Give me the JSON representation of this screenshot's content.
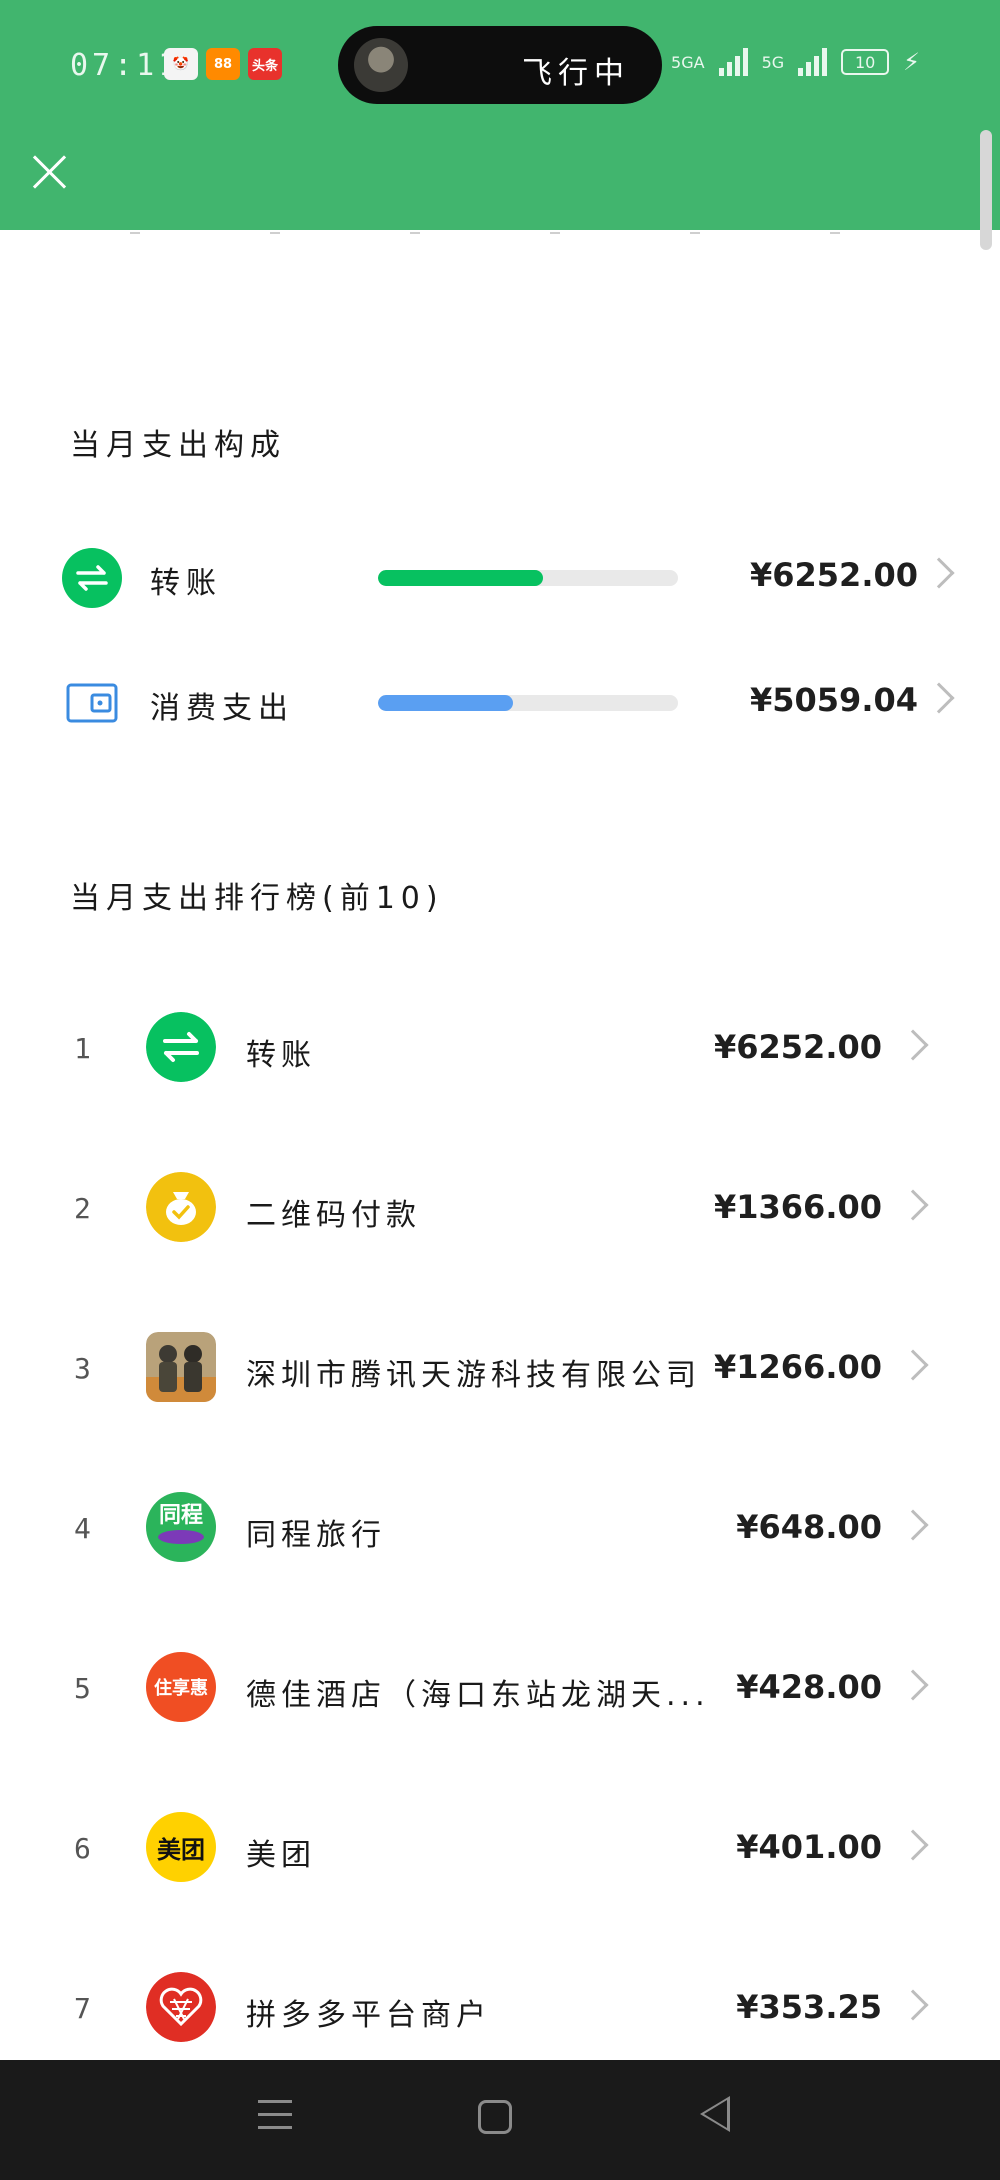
{
  "status_bar": {
    "time": "07:11",
    "apps": [
      {
        "label": "🤡",
        "color": "#f05a5a"
      },
      {
        "label": "88",
        "color": "#ff8a00"
      },
      {
        "label": "头条",
        "color": "#e8322c"
      }
    ],
    "pill_text": "飞行中",
    "network_1": "5GA",
    "network_2": "5G",
    "battery": "10"
  },
  "composition": {
    "title": "当月支出构成",
    "items": [
      {
        "label": "转账",
        "amount": "¥6252.00",
        "fill_percent": 55,
        "color": "#07c160",
        "icon": "transfer-icon"
      },
      {
        "label": "消费支出",
        "amount": "¥5059.04",
        "fill_percent": 45,
        "color": "#5a9ff2",
        "icon": "wallet-icon"
      }
    ]
  },
  "ranking": {
    "title": "当月支出排行榜(前10)",
    "items": [
      {
        "rank": "1",
        "name": "转账",
        "amount": "¥6252.00",
        "icon": "transfer-icon",
        "icon_color": "#07c160",
        "icon_text": "⇋"
      },
      {
        "rank": "2",
        "name": "二维码付款",
        "amount": "¥1366.00",
        "icon": "money-bag-icon",
        "icon_color": "#f2c10f",
        "icon_text": "✓"
      },
      {
        "rank": "3",
        "name": "深圳市腾讯天游科技有限公司",
        "amount": "¥1266.00",
        "icon": "game-app-icon",
        "icon_color": "#8a7a5e",
        "icon_text": ""
      },
      {
        "rank": "4",
        "name": "同程旅行",
        "amount": "¥648.00",
        "icon": "tongcheng-logo-icon",
        "icon_color": "#2bb45b",
        "icon_text": "同程"
      },
      {
        "rank": "5",
        "name": "德佳酒店（海口东站龙湖天...",
        "amount": "¥428.00",
        "icon": "zhuxianghui-logo-icon",
        "icon_color": "#f04e23",
        "icon_text": "住享惠"
      },
      {
        "rank": "6",
        "name": "美团",
        "amount": "¥401.00",
        "icon": "meituan-logo-icon",
        "icon_color": "#ffd100",
        "icon_text": "美团"
      },
      {
        "rank": "7",
        "name": "拼多多平台商户",
        "amount": "¥353.25",
        "icon": "pinduoduo-logo-icon",
        "icon_color": "#e02e24",
        "icon_text": ""
      }
    ]
  }
}
